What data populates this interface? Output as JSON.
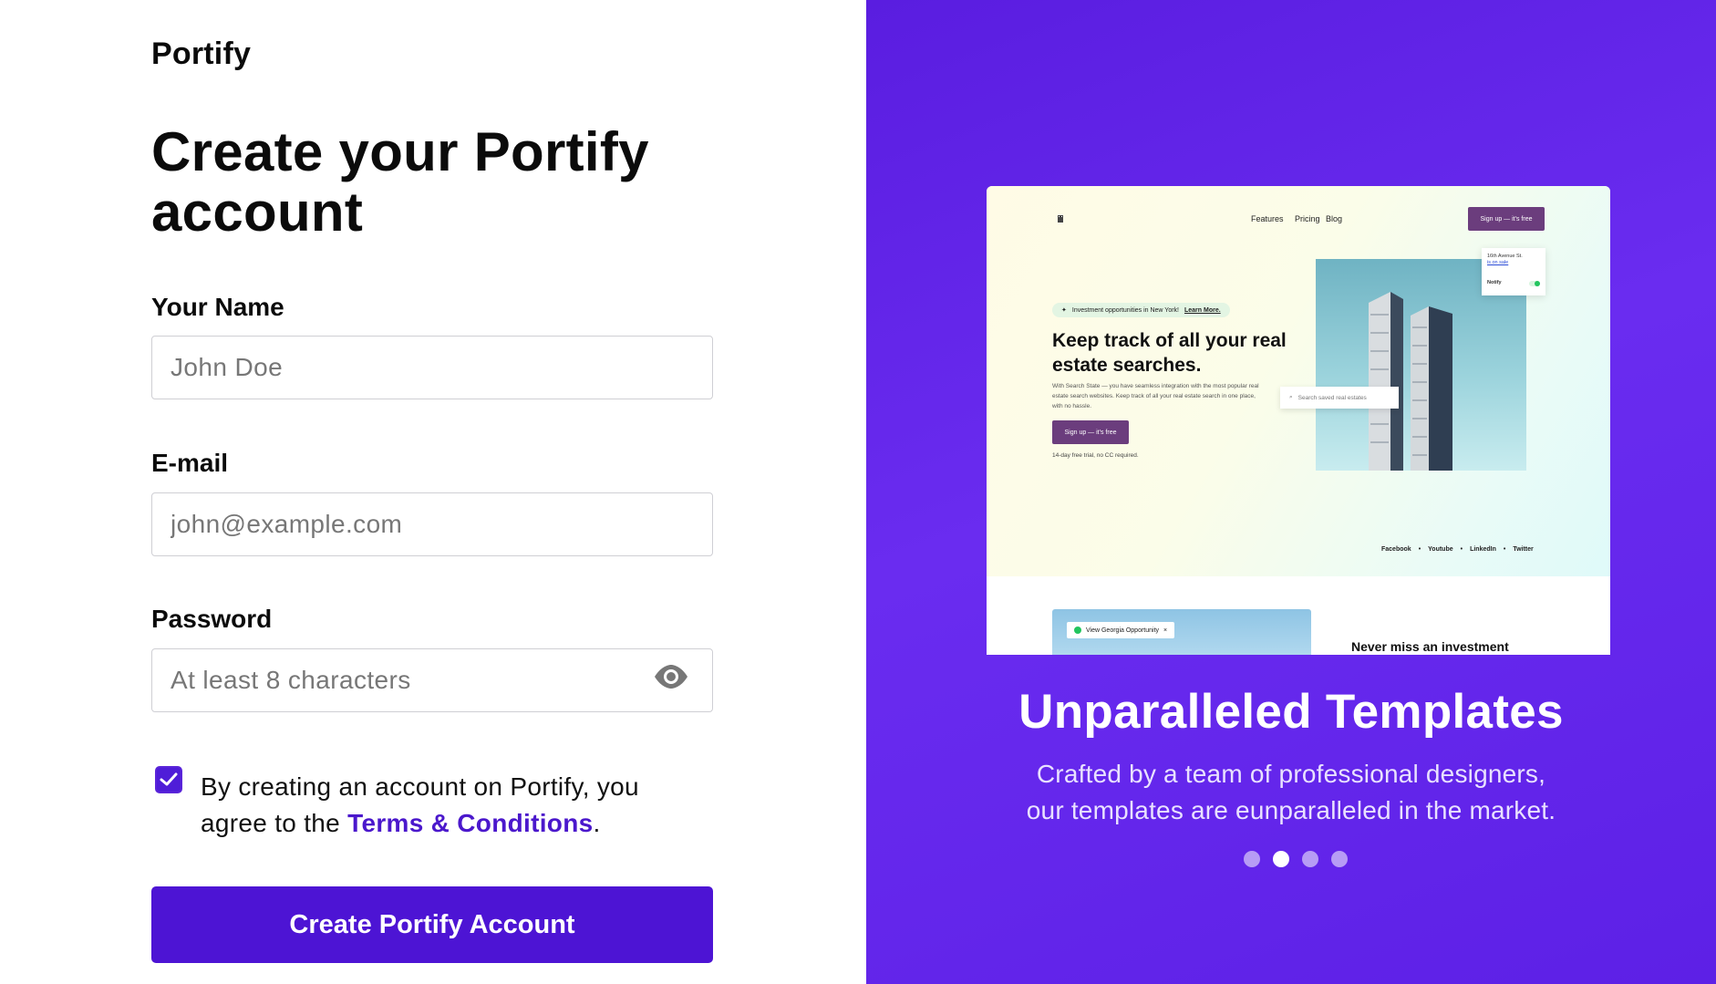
{
  "brand": "Portify",
  "form": {
    "title": "Create your Portify account",
    "name_label": "Your Name",
    "name_placeholder": "John Doe",
    "email_label": "E-mail",
    "email_placeholder": "john@example.com",
    "password_label": "Password",
    "password_placeholder": "At least 8 characters",
    "terms_checked": true,
    "terms_prefix": "By creating an account on Portify, you agree to the ",
    "terms_link": "Terms & Conditions",
    "terms_suffix": ".",
    "submit_label": "Create Portify Account"
  },
  "showcase": {
    "preview": {
      "nav": [
        "Features",
        "Pricing",
        "Blog"
      ],
      "signup": "Sign up — it's free",
      "pill_text": "Investment opportunities in New York!",
      "pill_link": "Learn More.",
      "heading": "Keep track of all your real estate searches.",
      "body": "With Search State — you have seamless integration with the most popular real estate search websites. Keep track of all your real estate search in one place, with no hassle.",
      "cta": "Sign up — it's free",
      "trial": "14-day free trial, no CC required.",
      "search_placeholder": "Search saved real estates",
      "notify_address": "16th Avenue St.",
      "notify_status": "is on sale",
      "notify_label": "Notify",
      "social": [
        "Facebook",
        "Youtube",
        "LinkedIn",
        "Twitter"
      ],
      "card_tag": "View Georgia Opportunity",
      "card_close": "×",
      "section_heading": "Never miss an investment"
    },
    "title": "Unparalleled Templates",
    "subtitle": "Crafted by a team of professional designers, our templates are eunparalleled in the market.",
    "slide_count": 4,
    "active_slide": 2
  },
  "colors": {
    "accent": "#4d14d4",
    "panel": "#6a2cf0",
    "dot_inactive": "#b79cf5",
    "dot_active": "#ffffff"
  },
  "icons": {
    "password_toggle": "eye-icon",
    "checkbox_mark": "checkmark-icon"
  }
}
